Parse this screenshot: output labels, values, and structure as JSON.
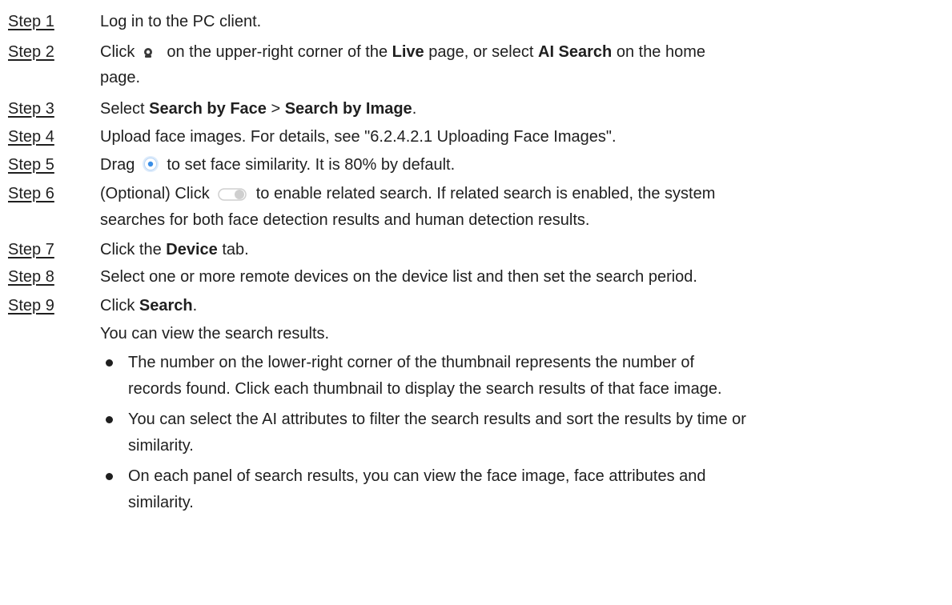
{
  "steps": [
    {
      "label": "Step 1",
      "text": "Log in to the PC client."
    },
    {
      "label": "Step 2",
      "t1": "Click",
      "t2": "on the upper-right corner of the",
      "b1": "Live",
      "t3": "page, or select",
      "b2": "AI Search",
      "t4": "on the home",
      "t5": "page."
    },
    {
      "label": "Step 3",
      "t1": "Select",
      "b1": "Search by Face",
      "t2": ">",
      "b2": "Search by Image",
      "t3": "."
    },
    {
      "label": "Step 4",
      "text": "Upload face images. For details, see \"6.2.4.2.1 Uploading Face Images\"."
    },
    {
      "label": "Step 5",
      "t1": "Drag",
      "t2": "to set face similarity. It is 80% by default."
    },
    {
      "label": "Step 6",
      "t1": "(Optional) Click",
      "t2": "to enable related search. If related search is enabled, the system",
      "t3": "searches for both face detection results and human detection results."
    },
    {
      "label": "Step 7",
      "t1": "Click the",
      "b1": "Device",
      "t2": "tab."
    },
    {
      "label": "Step 8",
      "text": "Select one or more remote devices on the device list and then set the search period."
    },
    {
      "label": "Step 9",
      "t1": "Click",
      "b1": "Search",
      "t2": "."
    }
  ],
  "result_intro": "You can view the search results.",
  "bullets": [
    {
      "l1": "The number on the lower-right corner of the thumbnail represents the number of",
      "l2": "records found. Click each thumbnail to display the search results of that face image."
    },
    {
      "l1": "You can select the AI attributes to filter the search results and sort the results by time or",
      "l2": "similarity."
    },
    {
      "l1": "On each panel of search results, you can view the face image, face attributes and",
      "l2": "similarity."
    }
  ],
  "icons": {
    "ai_search": "ai-search-icon",
    "similarity_handle": "slider-handle-icon",
    "related_toggle": "toggle-switch-icon"
  },
  "colors": {
    "text": "#1f1f1f",
    "handle_blue": "#3a8ee6",
    "toggle_gray": "#cfcfcf"
  }
}
